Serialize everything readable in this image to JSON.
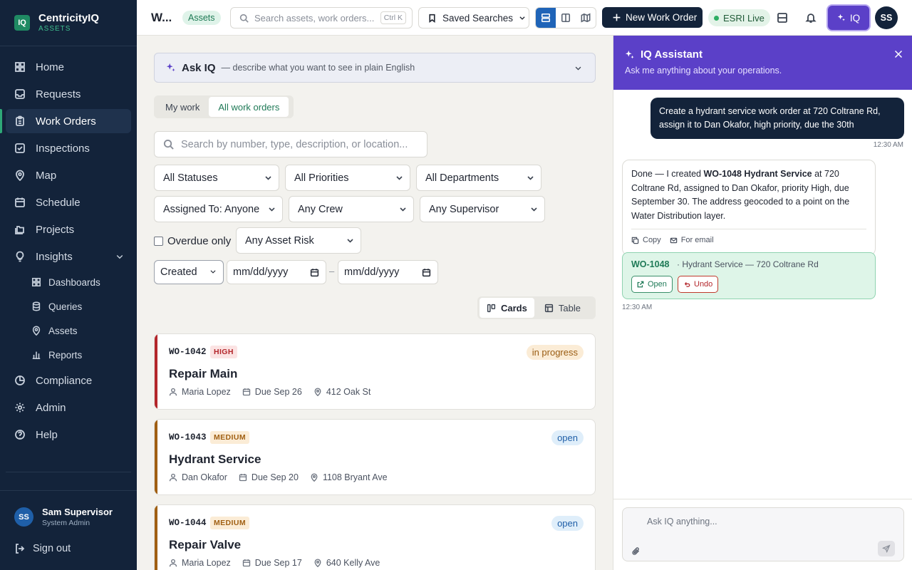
{
  "brand": {
    "name": "CentricityIQ",
    "sub": "ASSETS",
    "logo": "IQ"
  },
  "sidebar": {
    "items": [
      {
        "label": "Home",
        "icon": "grid-icon"
      },
      {
        "label": "Requests",
        "icon": "inbox-icon"
      },
      {
        "label": "Work Orders",
        "icon": "clipboard-icon"
      },
      {
        "label": "Inspections",
        "icon": "check-square-icon"
      },
      {
        "label": "Map",
        "icon": "map-pin-icon"
      },
      {
        "label": "Schedule",
        "icon": "calendar-icon"
      },
      {
        "label": "Projects",
        "icon": "folders-icon"
      },
      {
        "label": "Insights",
        "icon": "lightbulb-icon"
      }
    ],
    "sub_items": [
      {
        "label": "Dashboards",
        "icon": "dashboard-icon"
      },
      {
        "label": "Queries",
        "icon": "database-icon"
      },
      {
        "label": "Assets",
        "icon": "map-pin-icon"
      },
      {
        "label": "Reports",
        "icon": "bar-chart-icon"
      }
    ],
    "bottom_items": [
      {
        "label": "Compliance",
        "icon": "pie-icon"
      },
      {
        "label": "Admin",
        "icon": "gear-icon"
      },
      {
        "label": "Help",
        "icon": "help-icon"
      }
    ],
    "active": "Work Orders",
    "user": {
      "initials": "SS",
      "name": "Sam Supervisor",
      "role": "System Admin"
    },
    "signout": "Sign out"
  },
  "header": {
    "title": "W...",
    "badge": "Assets",
    "search_placeholder": "Search assets, work orders...",
    "search_shortcut": "Ctrl K",
    "saved_searches": "Saved Searches",
    "new_work_order": "New Work Order",
    "esri_status": "ESRI Live",
    "iq_button": "IQ",
    "avatar": "SS"
  },
  "main": {
    "ask_iq": {
      "title": "Ask IQ",
      "subtitle": "— describe what you want to see in plain English"
    },
    "tabs": [
      "My work",
      "All work orders"
    ],
    "active_tab": "All work orders",
    "search_placeholder": "Search by number, type, description, or location...",
    "filters": {
      "status": "All Statuses",
      "priority": "All Priorities",
      "department": "All Departments",
      "assigned": "Assigned To: Anyone",
      "crew": "Any Crew",
      "supervisor": "Any Supervisor",
      "overdue": "Overdue only",
      "asset_risk": "Any Asset Risk",
      "date_field": "Created",
      "date_from_placeholder": "mm/dd/yyyy",
      "date_to_placeholder": "mm/dd/yyyy",
      "date_separator": "–"
    },
    "view_modes": [
      "Cards",
      "Table"
    ],
    "active_view": "Cards",
    "work_orders": [
      {
        "number": "WO-1042",
        "priority": "HIGH",
        "status": "in progress",
        "title": "Repair Main",
        "assignee": "Maria Lopez",
        "due": "Due Sep 26",
        "location": "412 Oak St"
      },
      {
        "number": "WO-1043",
        "priority": "MEDIUM",
        "status": "open",
        "title": "Hydrant Service",
        "assignee": "Dan Okafor",
        "due": "Due Sep 20",
        "location": "1108 Bryant Ave"
      },
      {
        "number": "WO-1044",
        "priority": "MEDIUM",
        "status": "open",
        "title": "Repair Valve",
        "assignee": "Maria Lopez",
        "due": "Due Sep 17",
        "location": "640 Kelly Ave"
      }
    ]
  },
  "assistant": {
    "title": "IQ Assistant",
    "subtitle": "Ask me anything about your operations.",
    "user_message": "Create a hydrant service work order at 720 Coltrane Rd, assign it to Dan Okafor, high priority, due the 30th",
    "user_time": "12:30 AM",
    "reply": {
      "prefix": "Done — I created ",
      "bold": "WO-1048 Hydrant Service",
      "suffix": " at 720 Coltrane Rd, assigned to Dan Okafor, priority High, due September 30. The address geocoded to a point on the Water Distribution layer."
    },
    "copy_label": "Copy",
    "email_label": "For email",
    "created": {
      "number": "WO-1048",
      "description": "· Hydrant Service — 720 Coltrane Rd",
      "open_label": "Open",
      "undo_label": "Undo"
    },
    "reply_time": "12:30 AM",
    "input_placeholder": "Ask IQ anything..."
  },
  "colors": {
    "sidebar": "#13233a",
    "accent_green": "#1f8a63",
    "iq_purple": "#5b40c8",
    "high": "#b3262b",
    "medium": "#a05f12"
  }
}
